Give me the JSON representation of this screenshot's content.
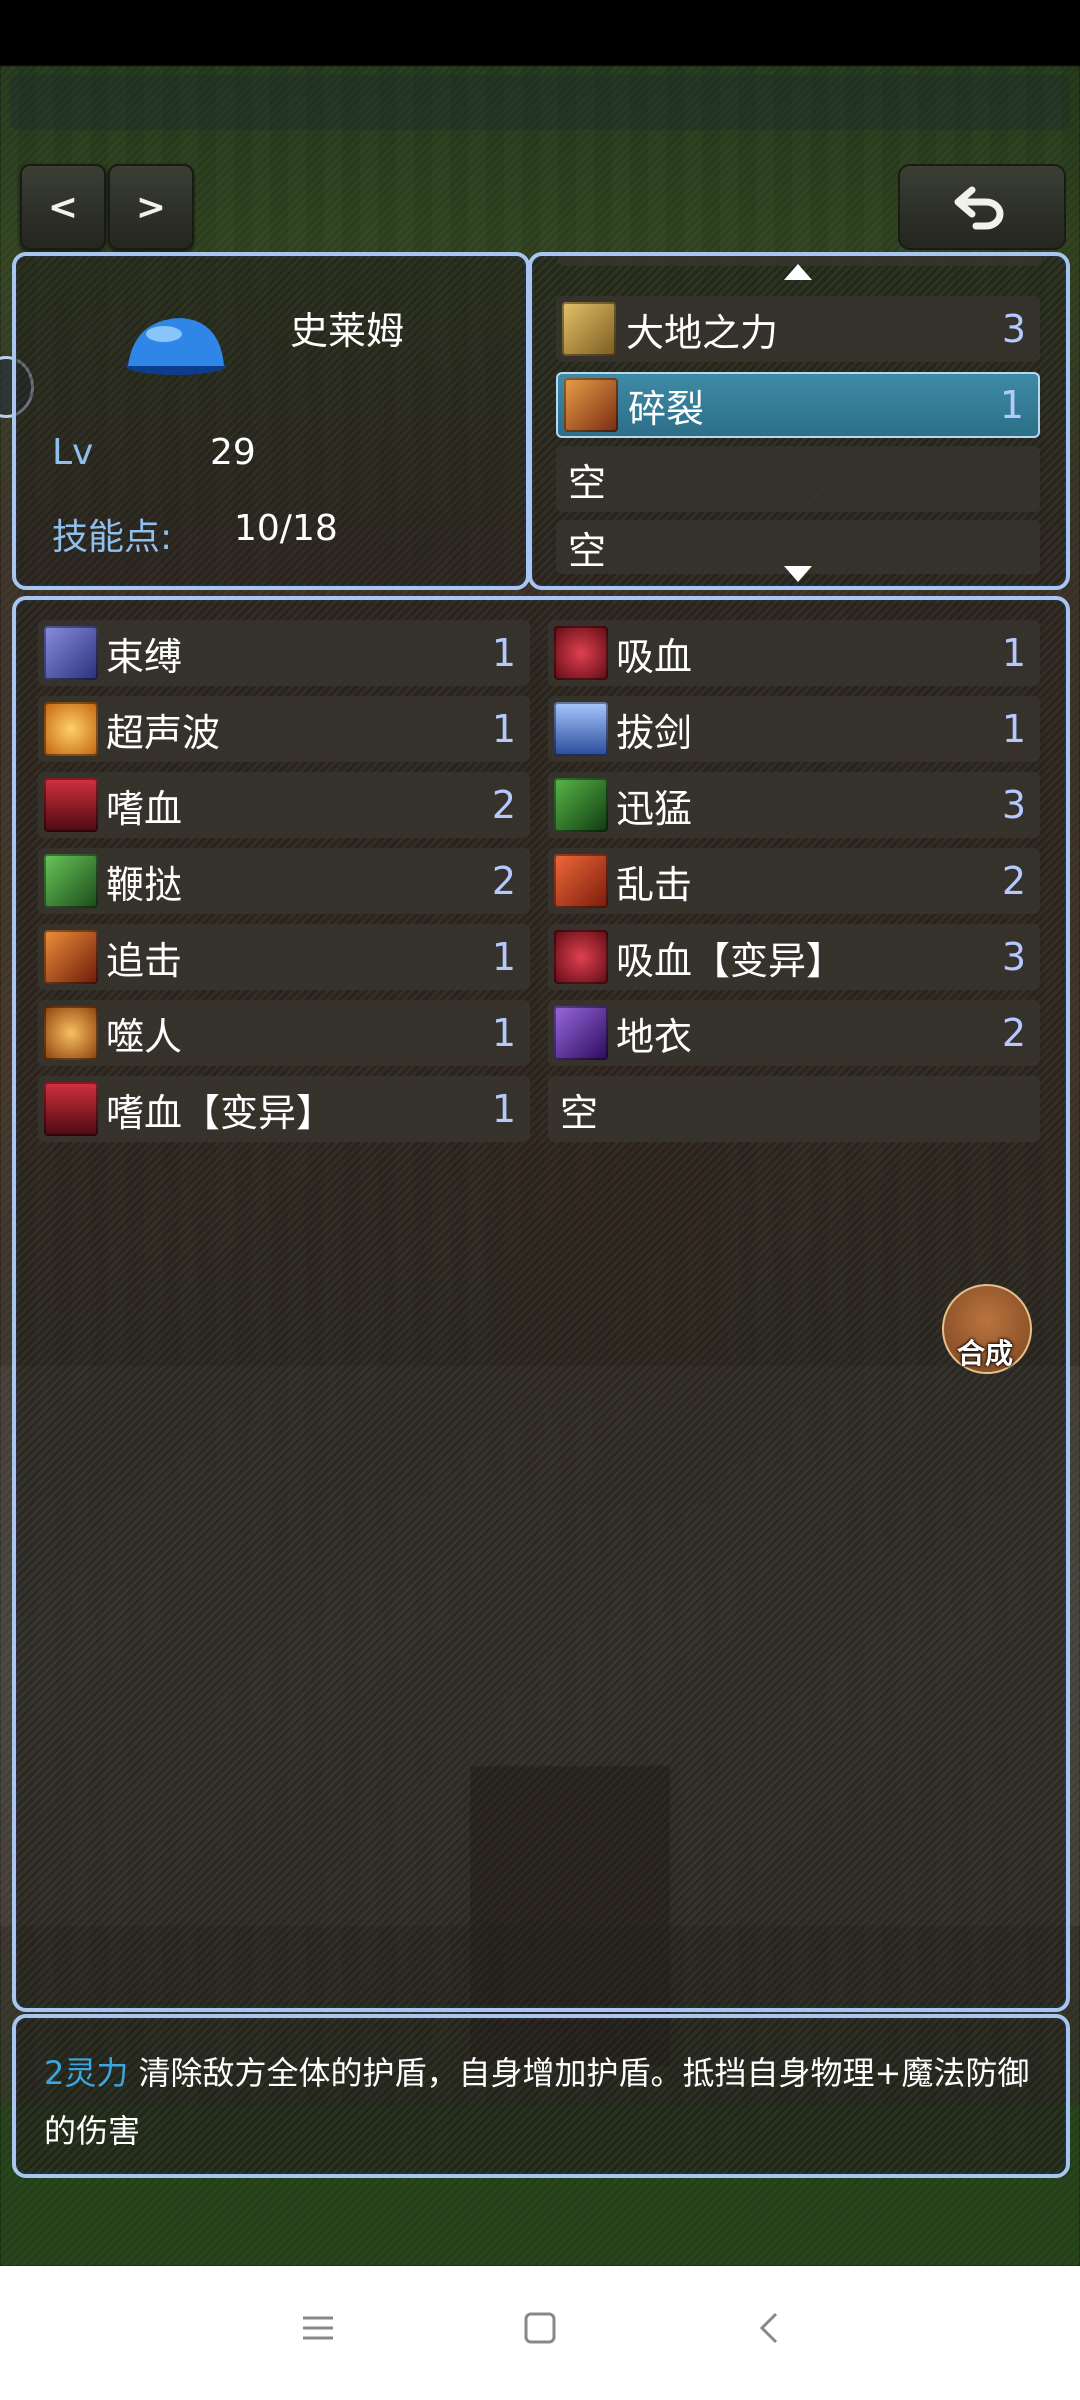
{
  "character": {
    "name": "史莱姆",
    "lv_label": "Lv",
    "lv_value": "29",
    "skill_points_label": "技能点:",
    "skill_points_value": "10/18"
  },
  "equipped_skills": [
    {
      "name": "大地之力",
      "count": "3",
      "icon": "earth-power-icon",
      "color": "#c9a24a"
    },
    {
      "name": "碎裂",
      "count": "1",
      "icon": "shatter-icon",
      "color": "#b8522a",
      "selected": true
    },
    {
      "name": "空",
      "count": ""
    },
    {
      "name": "空",
      "count": ""
    }
  ],
  "skills": {
    "left": [
      {
        "name": "束缚",
        "count": "1",
        "icon": "bind-icon",
        "color": "#5a5fb5"
      },
      {
        "name": "超声波",
        "count": "1",
        "icon": "ultrasonic-icon",
        "color": "#e08a1a"
      },
      {
        "name": "嗜血",
        "count": "2",
        "icon": "bloodthirst-icon",
        "color": "#8a1c22"
      },
      {
        "name": "鞭挞",
        "count": "2",
        "icon": "whip-icon",
        "color": "#3a8a3a"
      },
      {
        "name": "追击",
        "count": "1",
        "icon": "pursuit-icon",
        "color": "#c04a1a"
      },
      {
        "name": "噬人",
        "count": "1",
        "icon": "devour-icon",
        "color": "#d08a2a"
      },
      {
        "name": "嗜血【变异】",
        "count": "1",
        "icon": "bloodthirst-mutant-icon",
        "color": "#8a1c22"
      }
    ],
    "right": [
      {
        "name": "吸血",
        "count": "1",
        "icon": "vampire-icon",
        "color": "#b0202a"
      },
      {
        "name": "拔剑",
        "count": "1",
        "icon": "draw-sword-icon",
        "color": "#4a78c8"
      },
      {
        "name": "迅猛",
        "count": "3",
        "icon": "swift-icon",
        "color": "#2f7a2a"
      },
      {
        "name": "乱击",
        "count": "2",
        "icon": "chaos-strike-icon",
        "color": "#d0401a"
      },
      {
        "name": "吸血【变异】",
        "count": "3",
        "icon": "vampire-mutant-icon",
        "color": "#b0202a"
      },
      {
        "name": "地衣",
        "count": "2",
        "icon": "lichen-icon",
        "color": "#6a3ab0"
      },
      {
        "name": "空",
        "count": ""
      }
    ]
  },
  "description": {
    "cost": "2灵力",
    "text": " 清除敌方全体的护盾，自身增加护盾。抵挡自身物理+魔法防御的伤害"
  },
  "compose_label": "合成",
  "nav": {
    "prev": "<",
    "next": ">"
  },
  "colors": {
    "panel_border": "#a9c6f0",
    "label_blue": "#8fc0ec",
    "count_blue": "#b5c8ff",
    "cost_blue": "#3aa8e0"
  }
}
